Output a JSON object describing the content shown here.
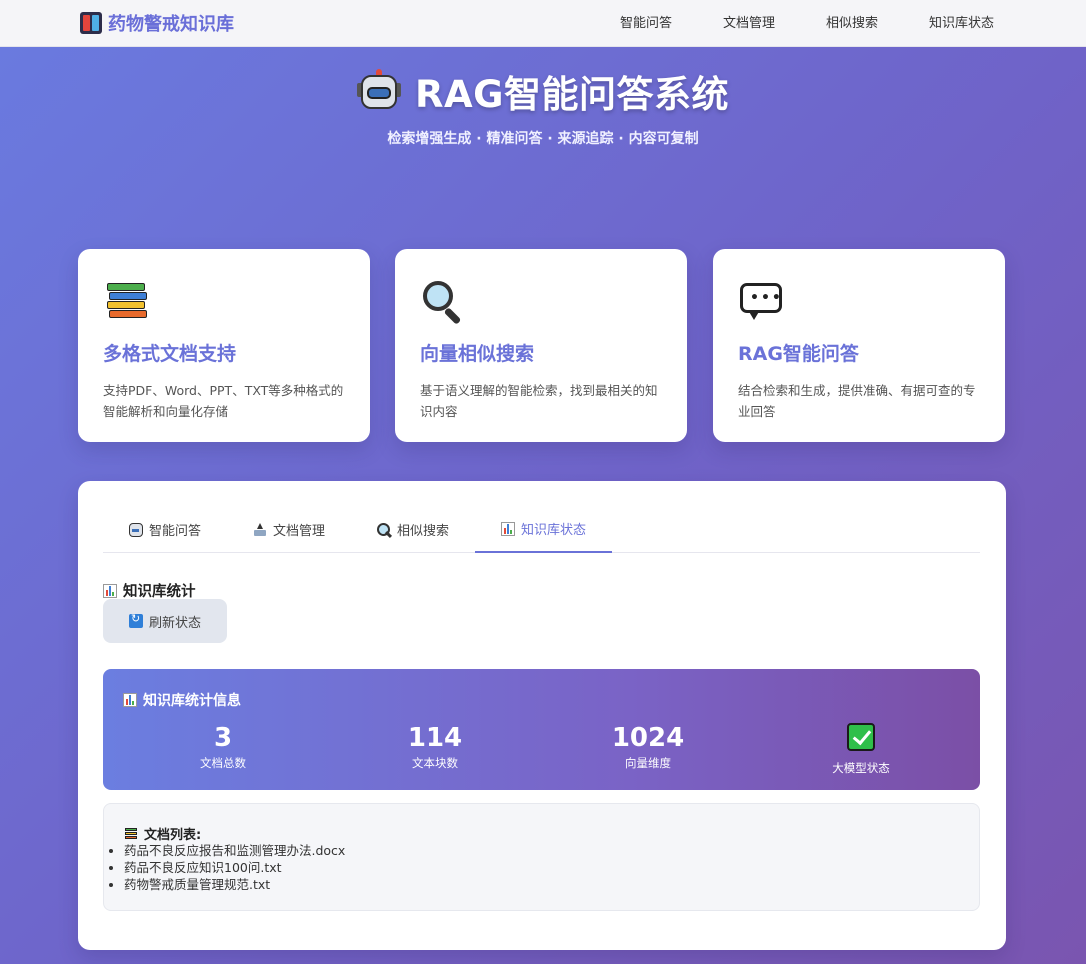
{
  "header": {
    "brand": "药物警戒知识库",
    "nav": [
      "智能问答",
      "文档管理",
      "相似搜索",
      "知识库状态"
    ]
  },
  "hero": {
    "title": "RAG智能问答系统",
    "subtitle": "检索增强生成 · 精准问答 · 来源追踪 · 内容可复制"
  },
  "features": [
    {
      "icon": "books-icon",
      "title": "多格式文档支持",
      "desc": "支持PDF、Word、PPT、TXT等多种格式的智能解析和向量化存储"
    },
    {
      "icon": "magnifier-icon",
      "title": "向量相似搜索",
      "desc": "基于语义理解的智能检索，找到最相关的知识内容"
    },
    {
      "icon": "speech-bubble-icon",
      "title": "RAG智能问答",
      "desc": "结合检索和生成，提供准确、有据可查的专业回答"
    }
  ],
  "tabs": [
    {
      "icon": "robot-icon",
      "label": "智能问答"
    },
    {
      "icon": "upload-icon",
      "label": "文档管理"
    },
    {
      "icon": "search-icon",
      "label": "相似搜索"
    },
    {
      "icon": "chart-icon",
      "label": "知识库状态",
      "active": true
    }
  ],
  "status": {
    "section_title": "知识库统计",
    "refresh_label": "刷新状态",
    "stats_title": "知识库统计信息",
    "stats": [
      {
        "value": "3",
        "label": "文档总数"
      },
      {
        "value": "114",
        "label": "文本块数"
      },
      {
        "value": "1024",
        "label": "向量维度"
      },
      {
        "value": "check-icon",
        "label": "大模型状态"
      }
    ],
    "doc_list_title": "文档列表:",
    "documents": [
      "药品不良反应报告和监测管理办法.docx",
      "药品不良反应知识100问.txt",
      "药物警戒质量管理规范.txt"
    ]
  },
  "colors": {
    "accent": "#6a72d8",
    "bg_gradient_start": "#6a7be0",
    "bg_gradient_end": "#7a55b0",
    "status_ok": "#2fbf4a"
  }
}
